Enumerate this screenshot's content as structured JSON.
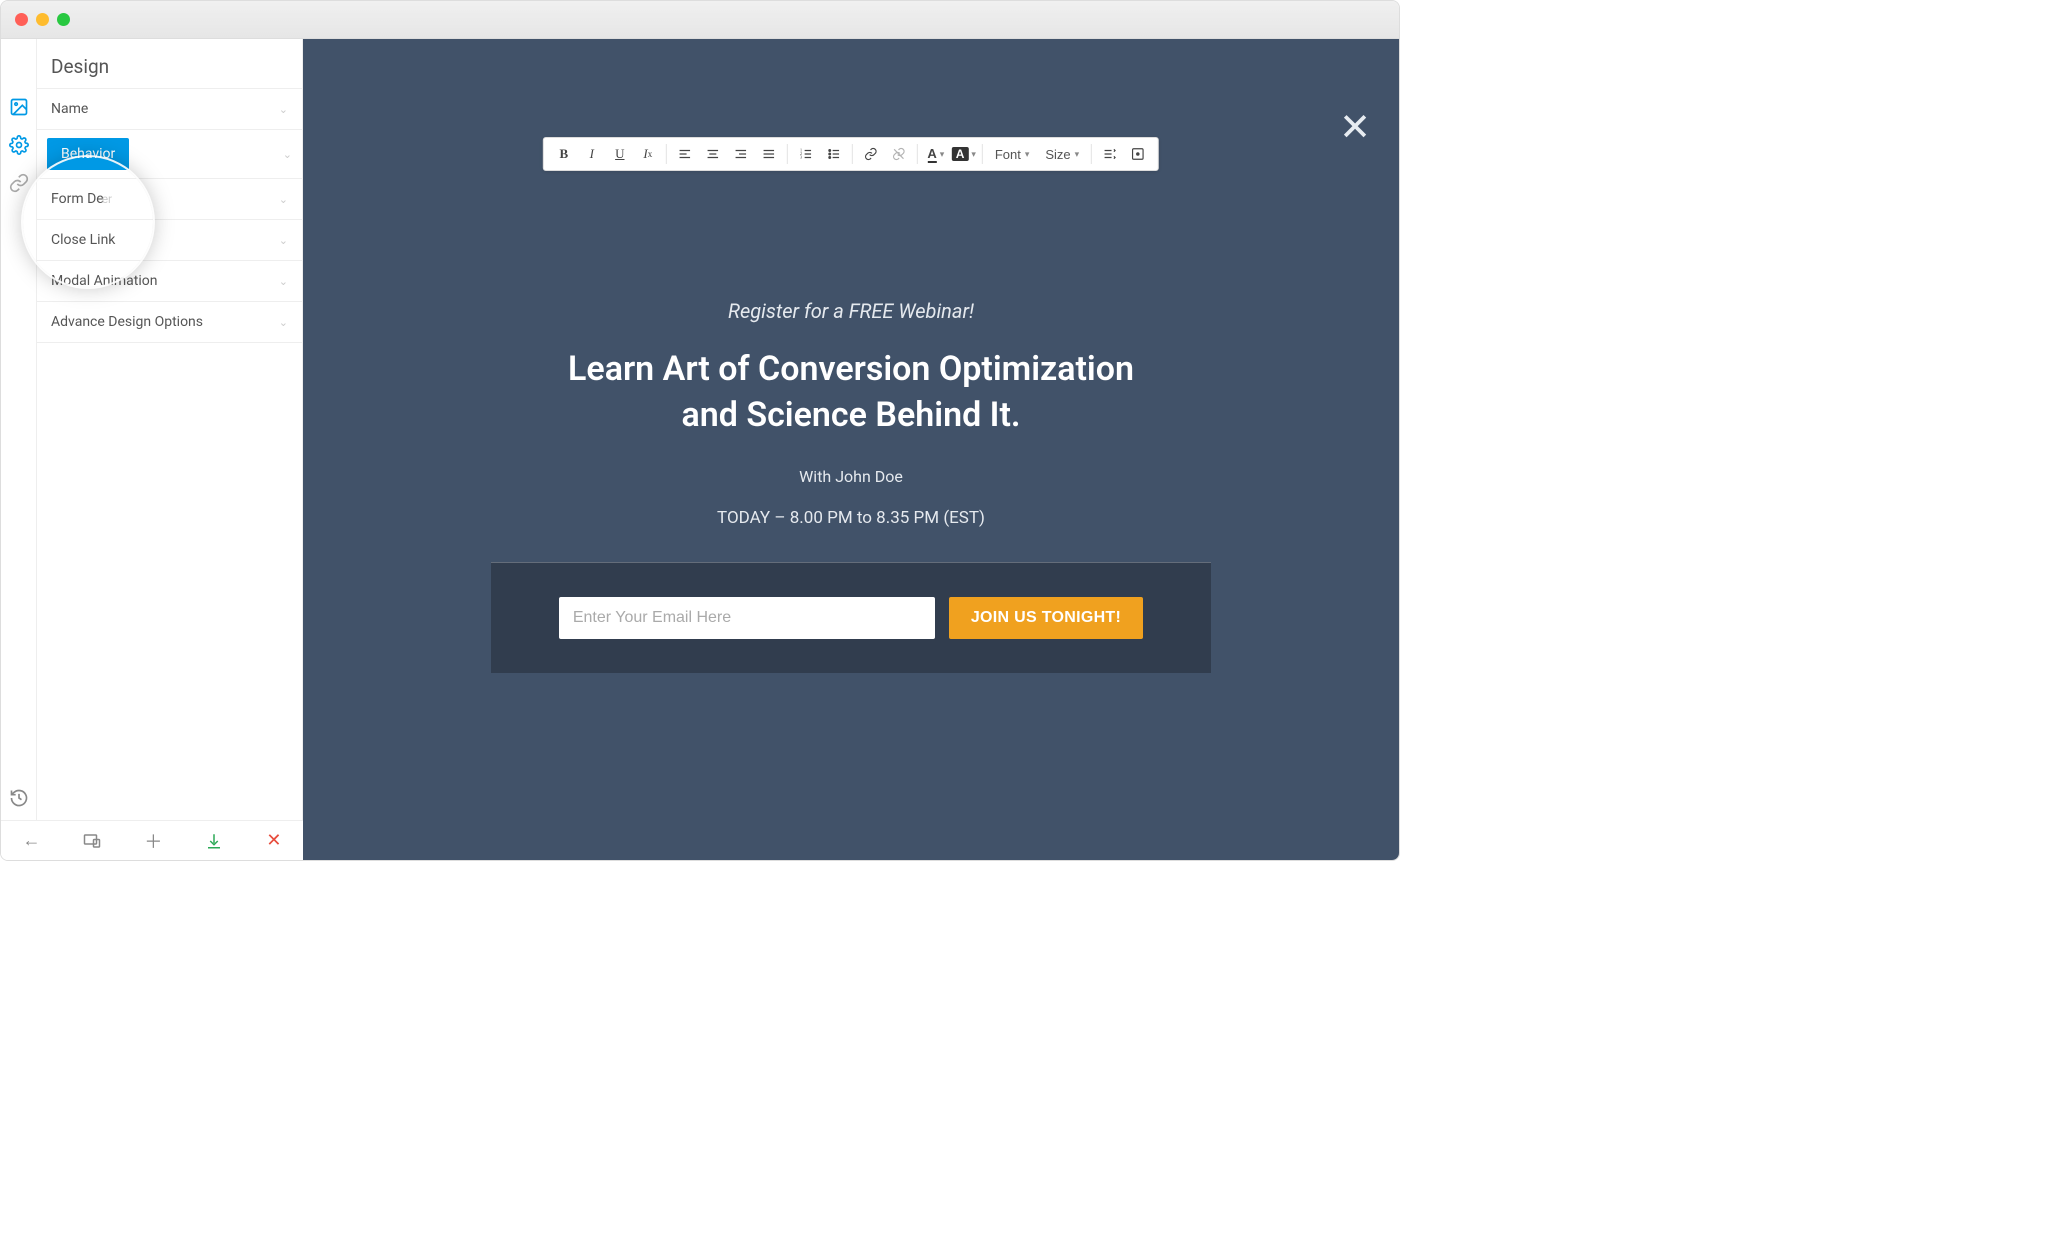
{
  "sidebar": {
    "title": "Design",
    "items": [
      {
        "label": "Name",
        "active": false
      },
      {
        "label": "Behavior",
        "active": true
      },
      {
        "label": "Form De",
        "stray": "er",
        "active": false
      },
      {
        "label": "Close Link",
        "active": false
      },
      {
        "label": "Modal Animation",
        "active": false
      },
      {
        "label": "Advance Design Options",
        "active": false
      }
    ]
  },
  "rte": {
    "font_label": "Font",
    "size_label": "Size"
  },
  "modal": {
    "pre": "Register for a FREE Webinar!",
    "headline_l1": "Learn Art of Conversion Optimization",
    "headline_l2": "and Science Behind It.",
    "sub": "With John Doe",
    "schedule": "TODAY – 8.00 PM to 8.35 PM (EST)",
    "email_placeholder": "Enter Your Email Here",
    "cta": "JOIN US TONIGHT!"
  }
}
